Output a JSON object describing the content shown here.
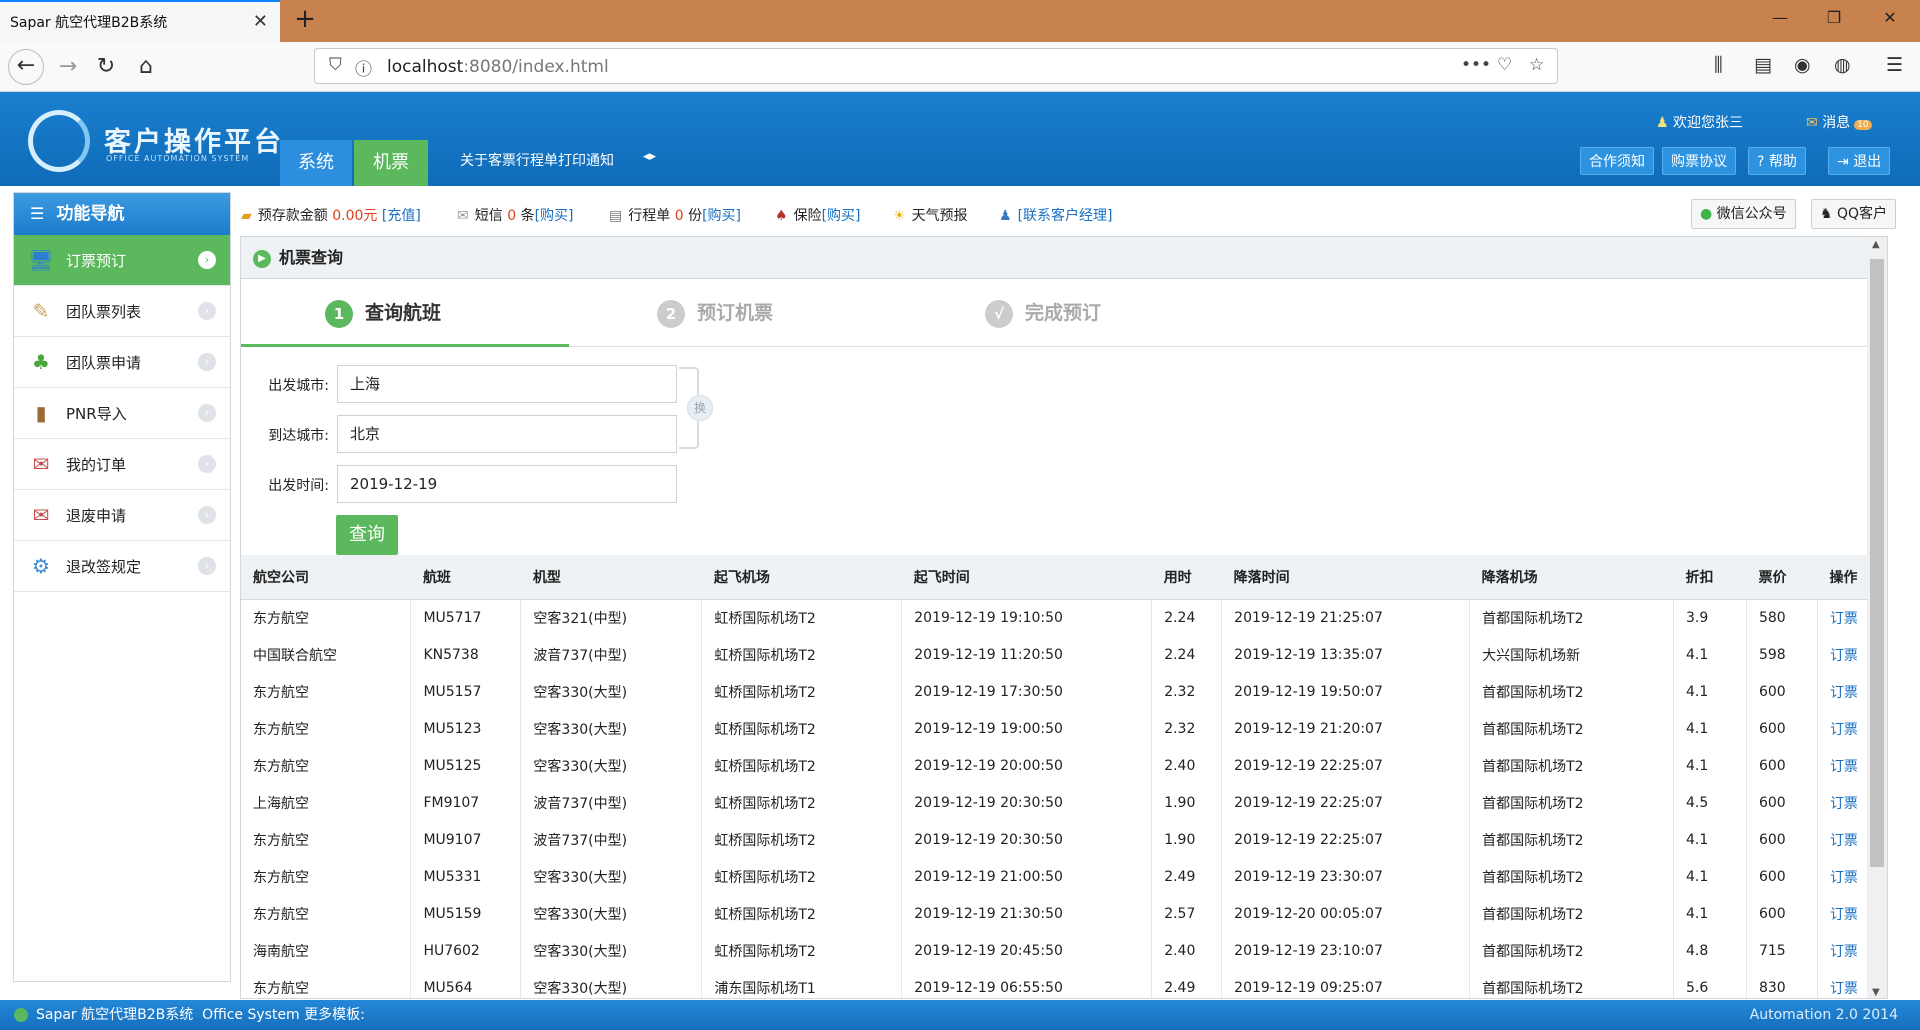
{
  "browser": {
    "tab_title": "Sapar 航空代理B2B系统",
    "url_host": "localhost",
    "url_rest": ":8080/index.html"
  },
  "header": {
    "logo_text": "客户操作平台",
    "logo_sub": "OFFICE AUTOMATION SYSTEM",
    "menu": [
      "系统",
      "机票"
    ],
    "notice": "关于客票行程单打印通知",
    "welcome": "欢迎您张三",
    "message_label": "消息",
    "message_count": "10",
    "buttons": [
      "合作须知",
      "购票协议",
      "帮助",
      "退出"
    ]
  },
  "sidebar": {
    "title": "功能导航",
    "items": [
      {
        "label": "订票预订",
        "icon": "monitor-icon",
        "active": true
      },
      {
        "label": "团队票列表",
        "icon": "notepad-icon",
        "active": false
      },
      {
        "label": "团队票申请",
        "icon": "tree-icon",
        "active": false
      },
      {
        "label": "PNR导入",
        "icon": "book-icon",
        "active": false
      },
      {
        "label": "我的订单",
        "icon": "envelope-icon",
        "active": false
      },
      {
        "label": "退废申请",
        "icon": "envelope-icon",
        "active": false
      },
      {
        "label": "退改签规定",
        "icon": "gears-icon",
        "active": false
      }
    ]
  },
  "infobar": {
    "deposit_label": "预存款金额",
    "deposit_value": "0.00元",
    "recharge": "[充值]",
    "sms_label": "短信",
    "sms_count": "0",
    "sms_unit": "条",
    "sms_buy": "[购买]",
    "itinerary_label": "行程单",
    "itinerary_count": "0",
    "itinerary_unit": "份",
    "itinerary_buy": "[购买]",
    "insurance_label": "保险",
    "insurance_buy": "[购买]",
    "weather": "天气预报",
    "contact": "[联系客户经理]",
    "wechat": "微信公众号",
    "qq": "QQ客户"
  },
  "panel": {
    "title": "机票查询",
    "steps": [
      {
        "num": "1",
        "label": "查询航班"
      },
      {
        "num": "2",
        "label": "预订机票"
      },
      {
        "num": "√",
        "label": "完成预订"
      }
    ],
    "form": {
      "from_label": "出发城市:",
      "from_value": "上海",
      "to_label": "到达城市:",
      "to_value": "北京",
      "date_label": "出发时间:",
      "date_value": "2019-12-19",
      "swap": "换",
      "search_button": "查询"
    },
    "table": {
      "headers": [
        "航空公司",
        "航班",
        "机型",
        "起飞机场",
        "起飞时间",
        "用时",
        "降落时间",
        "降落机场",
        "折扣",
        "票价",
        "操作"
      ],
      "rows": [
        [
          "东方航空",
          "MU5717",
          "空客321(中型)",
          "虹桥国际机场T2",
          "2019-12-19 19:10:50",
          "2.24",
          "2019-12-19 21:25:07",
          "首都国际机场T2",
          "3.9",
          "580",
          "订票"
        ],
        [
          "中国联合航空",
          "KN5738",
          "波音737(中型)",
          "虹桥国际机场T2",
          "2019-12-19 11:20:50",
          "2.24",
          "2019-12-19 13:35:07",
          "大兴国际机场新",
          "4.1",
          "598",
          "订票"
        ],
        [
          "东方航空",
          "MU5157",
          "空客330(大型)",
          "虹桥国际机场T2",
          "2019-12-19 17:30:50",
          "2.32",
          "2019-12-19 19:50:07",
          "首都国际机场T2",
          "4.1",
          "600",
          "订票"
        ],
        [
          "东方航空",
          "MU5123",
          "空客330(大型)",
          "虹桥国际机场T2",
          "2019-12-19 19:00:50",
          "2.32",
          "2019-12-19 21:20:07",
          "首都国际机场T2",
          "4.1",
          "600",
          "订票"
        ],
        [
          "东方航空",
          "MU5125",
          "空客330(大型)",
          "虹桥国际机场T2",
          "2019-12-19 20:00:50",
          "2.40",
          "2019-12-19 22:25:07",
          "首都国际机场T2",
          "4.1",
          "600",
          "订票"
        ],
        [
          "上海航空",
          "FM9107",
          "波音737(中型)",
          "虹桥国际机场T2",
          "2019-12-19 20:30:50",
          "1.90",
          "2019-12-19 22:25:07",
          "首都国际机场T2",
          "4.5",
          "600",
          "订票"
        ],
        [
          "东方航空",
          "MU9107",
          "波音737(中型)",
          "虹桥国际机场T2",
          "2019-12-19 20:30:50",
          "1.90",
          "2019-12-19 22:25:07",
          "首都国际机场T2",
          "4.1",
          "600",
          "订票"
        ],
        [
          "东方航空",
          "MU5331",
          "空客330(大型)",
          "虹桥国际机场T2",
          "2019-12-19 21:00:50",
          "2.49",
          "2019-12-19 23:30:07",
          "首都国际机场T2",
          "4.1",
          "600",
          "订票"
        ],
        [
          "东方航空",
          "MU5159",
          "空客330(大型)",
          "虹桥国际机场T2",
          "2019-12-19 21:30:50",
          "2.57",
          "2019-12-20 00:05:07",
          "首都国际机场T2",
          "4.1",
          "600",
          "订票"
        ],
        [
          "海南航空",
          "HU7602",
          "空客330(大型)",
          "虹桥国际机场T2",
          "2019-12-19 20:45:50",
          "2.40",
          "2019-12-19 23:10:07",
          "首都国际机场T2",
          "4.8",
          "715",
          "订票"
        ],
        [
          "东方航空",
          "MU564",
          "空客330(大型)",
          "浦东国际机场T1",
          "2019-12-19 06:55:50",
          "2.49",
          "2019-12-19 09:25:07",
          "首都国际机场T2",
          "5.6",
          "830",
          "订票"
        ]
      ]
    }
  },
  "footer": {
    "system": "Sapar 航空代理B2B系统",
    "office": "Office System",
    "more": "更多模板:",
    "version": "Automation 2.0 2014"
  },
  "colors": {
    "accent": "#1a7fcf",
    "green": "#5cb85c",
    "link": "#1a6fc0"
  }
}
